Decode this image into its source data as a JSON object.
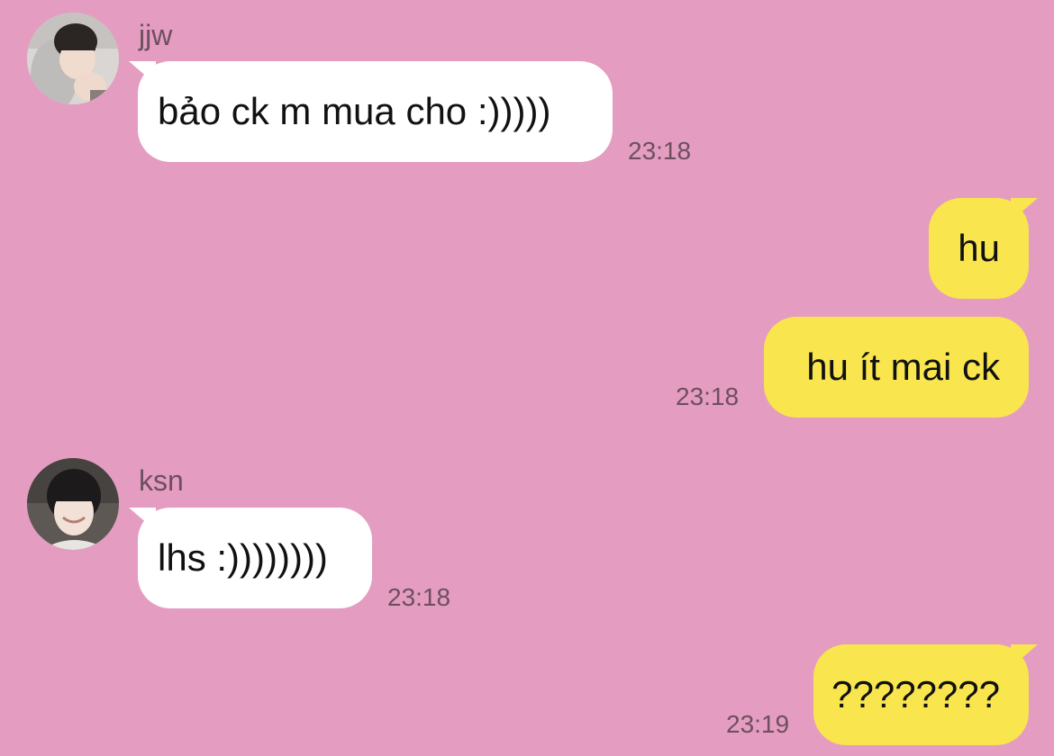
{
  "messages": [
    {
      "sender": "jjw",
      "avatar_icon": "person-in-gray-hoodie-photo",
      "text": "bảo ck m mua cho :)))))",
      "time": "23:18",
      "direction": "incoming"
    },
    {
      "text": "hu",
      "direction": "outgoing"
    },
    {
      "text": "hu ít mai ck",
      "time": "23:18",
      "direction": "outgoing"
    },
    {
      "sender": "ksn",
      "avatar_icon": "smiling-person-photo",
      "text": "lhs :))))))))",
      "time": "23:18",
      "direction": "incoming"
    },
    {
      "text": "????????",
      "time": "23:19",
      "direction": "outgoing"
    }
  ],
  "colors": {
    "background": "#e49dc0",
    "incoming_bubble": "#ffffff",
    "outgoing_bubble": "#f9e54e",
    "meta_text": "#6d4f5f"
  }
}
